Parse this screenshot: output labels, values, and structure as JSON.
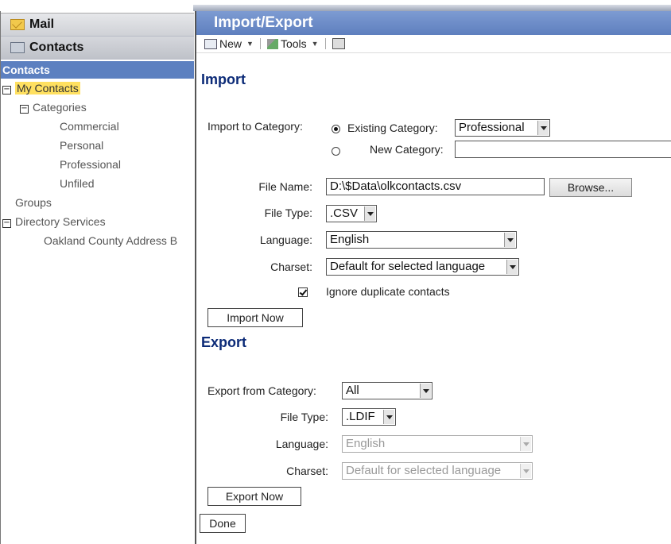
{
  "nav": {
    "mail_label": "Mail",
    "contacts_label": "Contacts",
    "section_title": "Contacts",
    "tree": {
      "my_contacts": "My Contacts",
      "categories": "Categories",
      "category_items": [
        "Commercial",
        "Personal",
        "Professional",
        "Unfiled"
      ],
      "groups": "Groups",
      "directory_services": "Directory Services",
      "directory_item": "Oakland County Address B"
    }
  },
  "panel": {
    "title": "Import/Export",
    "toolbar": {
      "new_label": "New",
      "tools_label": "Tools"
    }
  },
  "import": {
    "heading": "Import",
    "category_label": "Import to Category:",
    "existing_label": "Existing Category:",
    "existing_value": "Professional",
    "new_label": "New Category:",
    "new_value": "",
    "file_name_label": "File Name:",
    "file_name_value": "D:\\$Data\\olkcontacts.csv",
    "browse_label": "Browse...",
    "file_type_label": "File Type:",
    "file_type_value": ".CSV",
    "language_label": "Language:",
    "language_value": "English",
    "charset_label": "Charset:",
    "charset_value": "Default for selected language",
    "ignore_label": "Ignore duplicate contacts",
    "button_label": "Import Now"
  },
  "export": {
    "heading": "Export",
    "category_label": "Export from Category:",
    "category_value": "All",
    "file_type_label": "File Type:",
    "file_type_value": ".LDIF",
    "language_label": "Language:",
    "language_value": "English",
    "charset_label": "Charset:",
    "charset_value": "Default for selected language",
    "button_label": "Export Now"
  },
  "done_label": "Done"
}
